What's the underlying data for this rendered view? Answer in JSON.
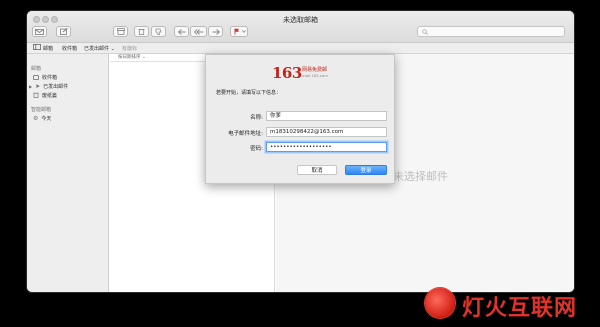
{
  "window": {
    "title": "未选取邮箱"
  },
  "search": {
    "placeholder": ""
  },
  "favorites_bar": {
    "mailboxes_label": "邮箱",
    "inbox_label": "收件箱",
    "sent_label": "已发出邮件",
    "flagged_label": "有旗标"
  },
  "sidebar": {
    "mailboxes_header": "邮箱",
    "items": [
      {
        "label": "收件箱",
        "icon": "inbox-icon"
      },
      {
        "label": "已发出邮件",
        "icon": "sent-icon"
      },
      {
        "label": "废纸篓",
        "icon": "trash-icon"
      }
    ],
    "smart_header": "智能邮箱",
    "smart_items": [
      {
        "label": "今天",
        "icon": "gear-icon"
      }
    ]
  },
  "message_list": {
    "sort_label": "按日期排序"
  },
  "preview": {
    "empty_message": "未选择邮件"
  },
  "dialog": {
    "logo_number": "163",
    "logo_name": "网易免费邮",
    "logo_url": "mail.163.com",
    "intro": "若要开始，请填写以下信息：",
    "fields": {
      "name_label": "名称:",
      "name_value": "你爹",
      "email_label": "电子邮件地址:",
      "email_value": "m18310298422@163.com",
      "password_label": "密码:",
      "password_value": "•••••••••••••••••••"
    },
    "cancel_label": "取消",
    "login_label": "登录"
  },
  "watermark": {
    "text": "灯火互联网"
  },
  "colors": {
    "accent": "#2e86f0",
    "brand": "#c0241a",
    "watermark": "#e2332a"
  }
}
